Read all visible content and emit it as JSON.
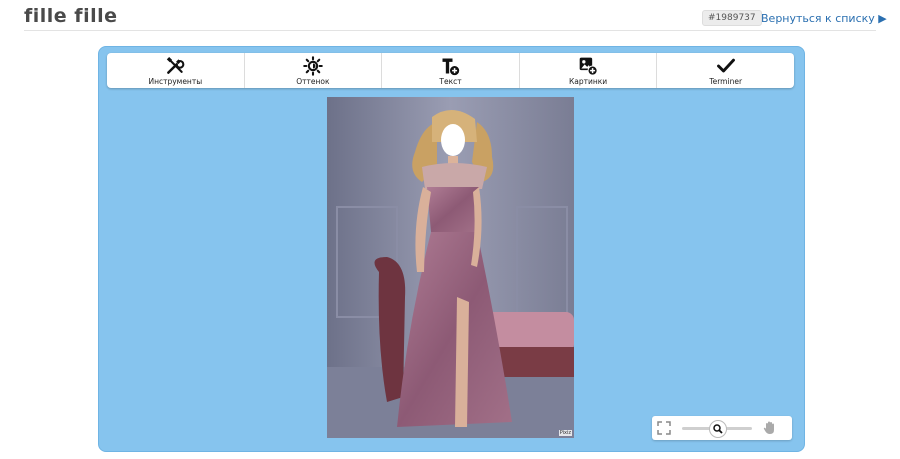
{
  "header": {
    "title": "fille fille",
    "badge": "#1989737",
    "back_link": "Вернуться к списку ▶"
  },
  "toolbar": {
    "items": [
      {
        "label": "Инструменты",
        "icon": "tools-icon"
      },
      {
        "label": "Оттенок",
        "icon": "brightness-icon"
      },
      {
        "label": "Текст",
        "icon": "text-add-icon"
      },
      {
        "label": "Картинки",
        "icon": "image-add-icon"
      },
      {
        "label": "Terminer",
        "icon": "checkmark-icon"
      }
    ]
  },
  "canvas": {
    "watermark": "Pixiz"
  },
  "zoom": {
    "level": 0.5,
    "icons": [
      "fullscreen-icon",
      "zoom-magnifier-icon",
      "pan-hand-icon"
    ]
  },
  "colors": {
    "editor_bg": "#86c4ee",
    "link": "#2a6fb0"
  }
}
